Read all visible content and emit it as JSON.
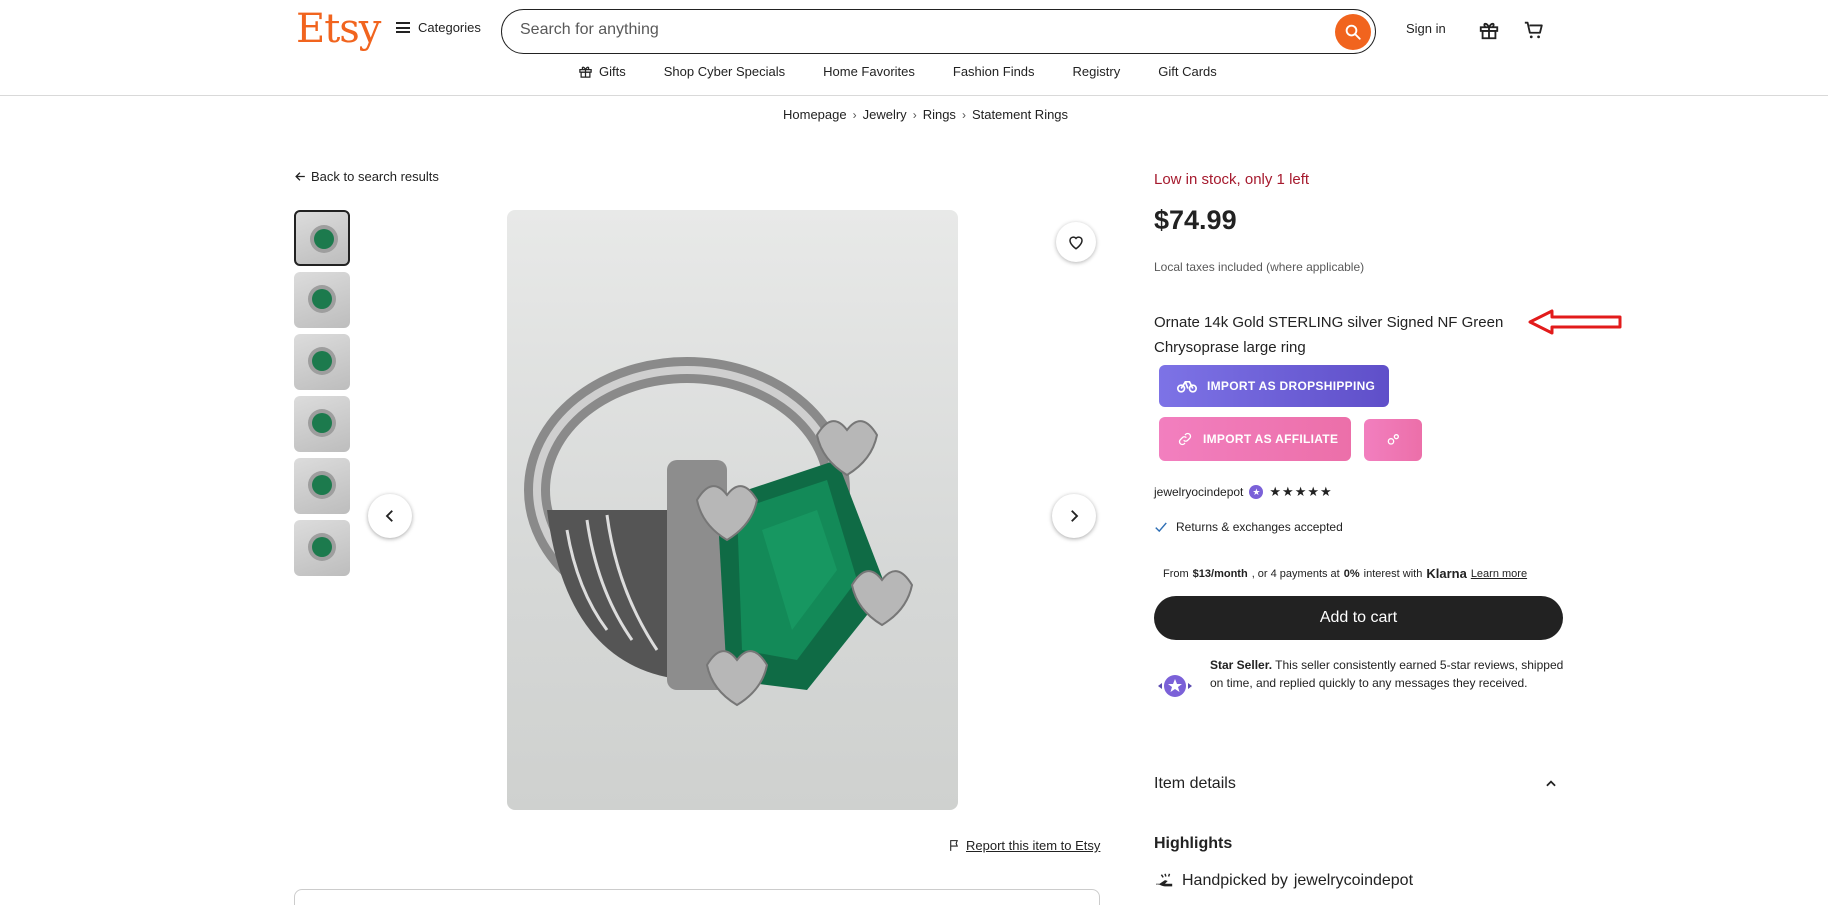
{
  "header": {
    "logo": "Etsy",
    "categories_label": "Categories",
    "search_placeholder": "Search for anything",
    "signin_label": "Sign in",
    "brand_color": "#f1641e"
  },
  "nav": {
    "items": [
      {
        "label": "Gifts",
        "icon": "gift-icon"
      },
      {
        "label": "Shop Cyber Specials"
      },
      {
        "label": "Home Favorites"
      },
      {
        "label": "Fashion Finds"
      },
      {
        "label": "Registry"
      },
      {
        "label": "Gift Cards"
      }
    ]
  },
  "breadcrumb": [
    "Homepage",
    "Jewelry",
    "Rings",
    "Statement Rings"
  ],
  "gallery": {
    "back_label": "Back to search results",
    "thumbnail_count": 6,
    "report_label": "Report this item to Etsy"
  },
  "listing": {
    "stock_text": "Low in stock, only 1 left",
    "price": "$74.99",
    "tax_note": "Local taxes included (where applicable)",
    "title": "Ornate 14k Gold STERLING silver Signed NF Green Chrysoprase large ring",
    "import_dropshipping_label": "IMPORT AS DROPSHIPPING",
    "import_affiliate_label": "IMPORT AS AFFILIATE",
    "seller_name": "jewelryocindepot",
    "stars": "★★★★★",
    "returns_text": "Returns & exchanges accepted",
    "klarna": {
      "prefix": "From",
      "amount": "$13/month",
      "middle": ", or 4 payments at",
      "rate": "0%",
      "suffix": "interest with",
      "brand": "Klarna",
      "learn_more": "Learn more"
    },
    "add_to_cart_label": "Add to cart",
    "star_seller_title": "Star Seller.",
    "star_seller_text": " This seller consistently earned 5-star reviews, shipped on time, and replied quickly to any messages they received.",
    "item_details_label": "Item details",
    "highlights_label": "Highlights",
    "handpicked_prefix": "Handpicked by",
    "handpicked_seller": "jewelrycoindepot",
    "stock_color": "#a61a2e"
  }
}
